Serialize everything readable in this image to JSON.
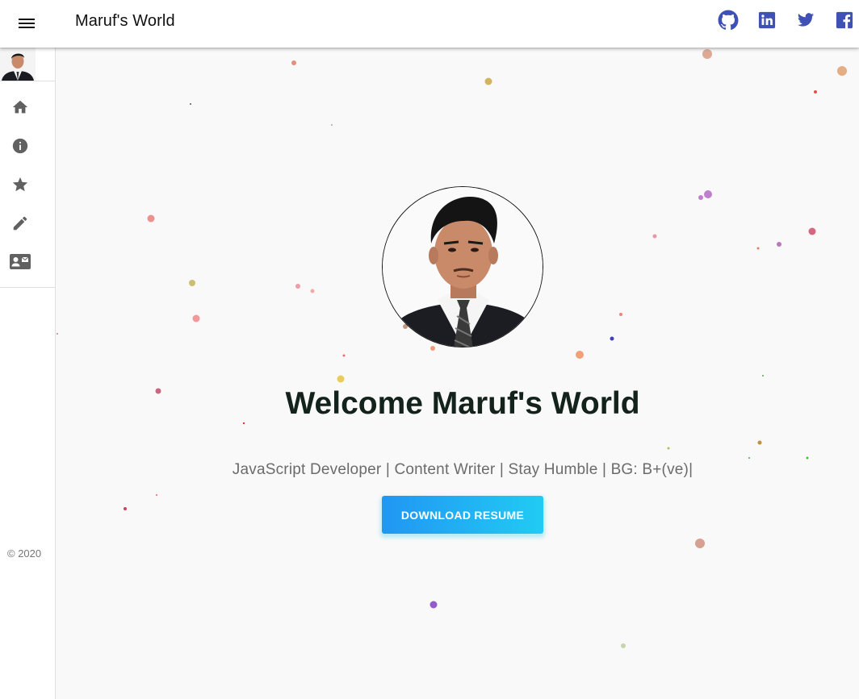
{
  "header": {
    "title": "Maruf's World",
    "menu_icon": "hamburger-menu-icon",
    "social_links": [
      {
        "name": "github-icon"
      },
      {
        "name": "linkedin-icon"
      },
      {
        "name": "twitter-icon"
      },
      {
        "name": "facebook-icon"
      }
    ],
    "social_color": "#3f51b5"
  },
  "sidebar": {
    "items": [
      {
        "name": "home-icon"
      },
      {
        "name": "info-icon"
      },
      {
        "name": "star-icon"
      },
      {
        "name": "pencil-icon"
      },
      {
        "name": "contact-card-icon"
      }
    ],
    "icon_color": "#616161",
    "copyright": "© 2020"
  },
  "hero": {
    "title": "Welcome Maruf's World",
    "subtitle": "JavaScript Developer | Content Writer | Stay Humble | BG: B+(ve)|",
    "button_label": "DOWNLOAD RESUME",
    "button_gradient": [
      "#2196f3",
      "#21cbf3"
    ]
  }
}
